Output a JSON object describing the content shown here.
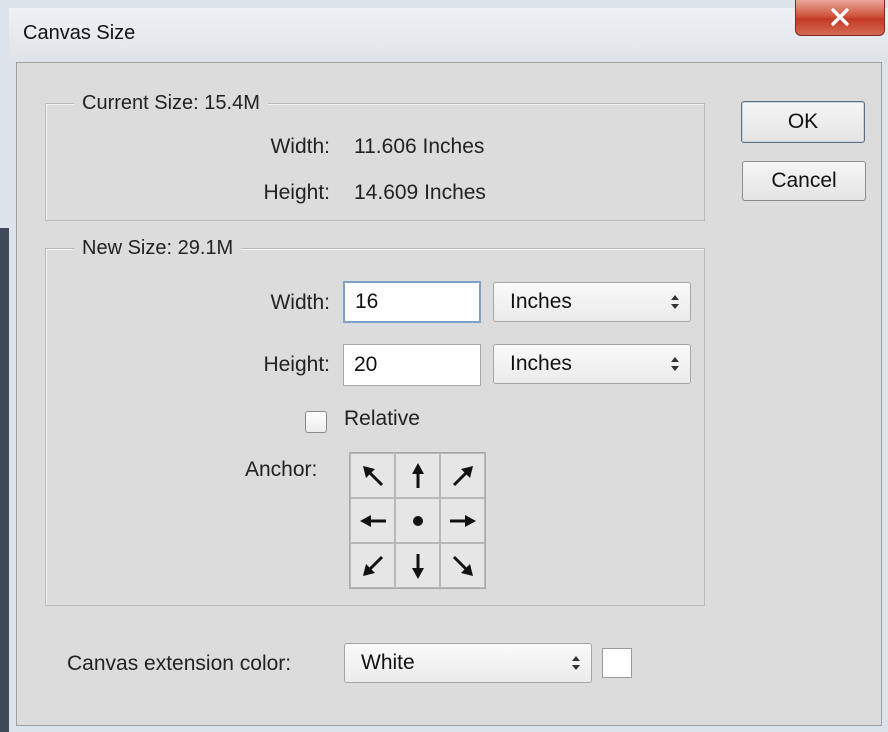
{
  "window": {
    "title": "Canvas Size"
  },
  "current_size": {
    "legend": "Current Size: 15.4M",
    "width_label": "Width:",
    "width_value": "11.606 Inches",
    "height_label": "Height:",
    "height_value": "14.609 Inches"
  },
  "new_size": {
    "legend": "New Size: 29.1M",
    "width_label": "Width:",
    "width_value": "16",
    "width_unit": "Inches",
    "height_label": "Height:",
    "height_value": "20",
    "height_unit": "Inches",
    "relative_label": "Relative",
    "relative_checked": false,
    "anchor_label": "Anchor:",
    "anchor_cells": [
      "arrow-up-left-icon",
      "arrow-up-icon",
      "arrow-up-right-icon",
      "arrow-left-icon",
      "center-dot-icon",
      "arrow-right-icon",
      "arrow-down-left-icon",
      "arrow-down-icon",
      "arrow-down-right-icon"
    ]
  },
  "extension": {
    "label": "Canvas extension color:",
    "value": "White",
    "swatch_color": "#ffffff"
  },
  "buttons": {
    "ok": "OK",
    "cancel": "Cancel"
  },
  "colors": {
    "dialog_bg": "#dcdcdc",
    "close_button": "#c13a25",
    "focus_border": "#7da2c8"
  }
}
